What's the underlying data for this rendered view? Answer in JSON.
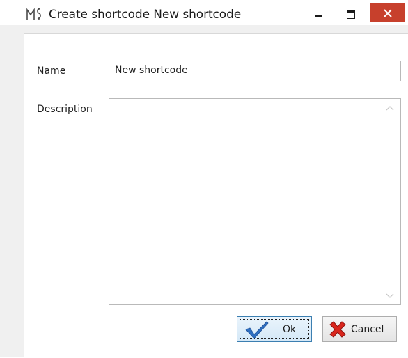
{
  "window": {
    "logo_text": "M$",
    "title": "Create shortcode New shortcode",
    "controls": {
      "minimize_icon": "minimize-icon",
      "maximize_icon": "maximize-icon",
      "close_icon": "close-icon",
      "close_color": "#c7402c"
    }
  },
  "form": {
    "name_label": "Name",
    "name_value": "New shortcode",
    "description_label": "Description",
    "description_value": ""
  },
  "buttons": {
    "ok_label": "Ok",
    "ok_icon": "checkmark-icon",
    "cancel_label": "Cancel",
    "cancel_icon": "red-x-icon"
  }
}
